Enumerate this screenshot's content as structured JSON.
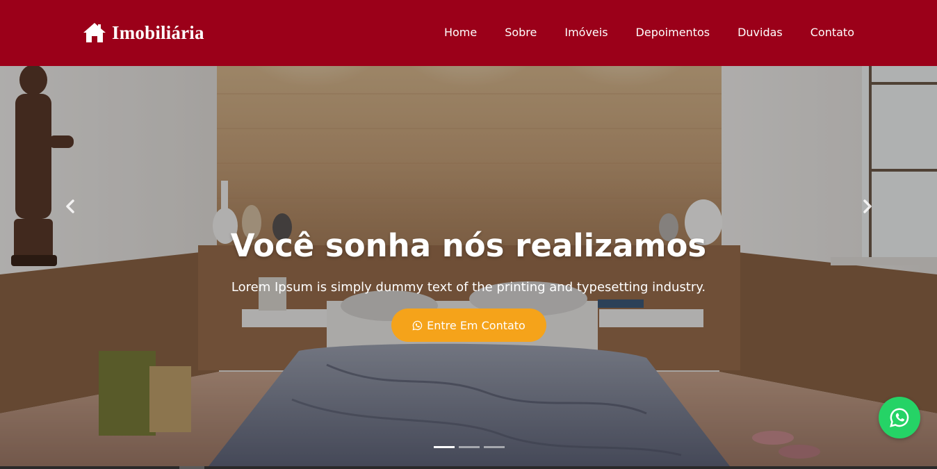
{
  "brand": {
    "name": "Imobiliária",
    "icon": "home-icon"
  },
  "nav": {
    "items": [
      {
        "label": "Home"
      },
      {
        "label": "Sobre"
      },
      {
        "label": "Imóveis"
      },
      {
        "label": "Depoimentos"
      },
      {
        "label": "Duvidas"
      },
      {
        "label": "Contato"
      }
    ]
  },
  "hero": {
    "headline": "Você sonha nós realizamos",
    "subline": "Lorem Ipsum is simply dummy text of the printing and typesetting industry.",
    "cta_label": "Entre Em Contato",
    "cta_icon": "whatsapp-icon",
    "prev_icon": "chevron-left-icon",
    "next_icon": "chevron-right-icon",
    "slides_count": 3,
    "active_slide": 1
  },
  "float_button": {
    "icon": "whatsapp-icon"
  },
  "colors": {
    "navbar": "#9b0019",
    "accent": "#f5a31a",
    "whatsapp": "#25d366"
  }
}
